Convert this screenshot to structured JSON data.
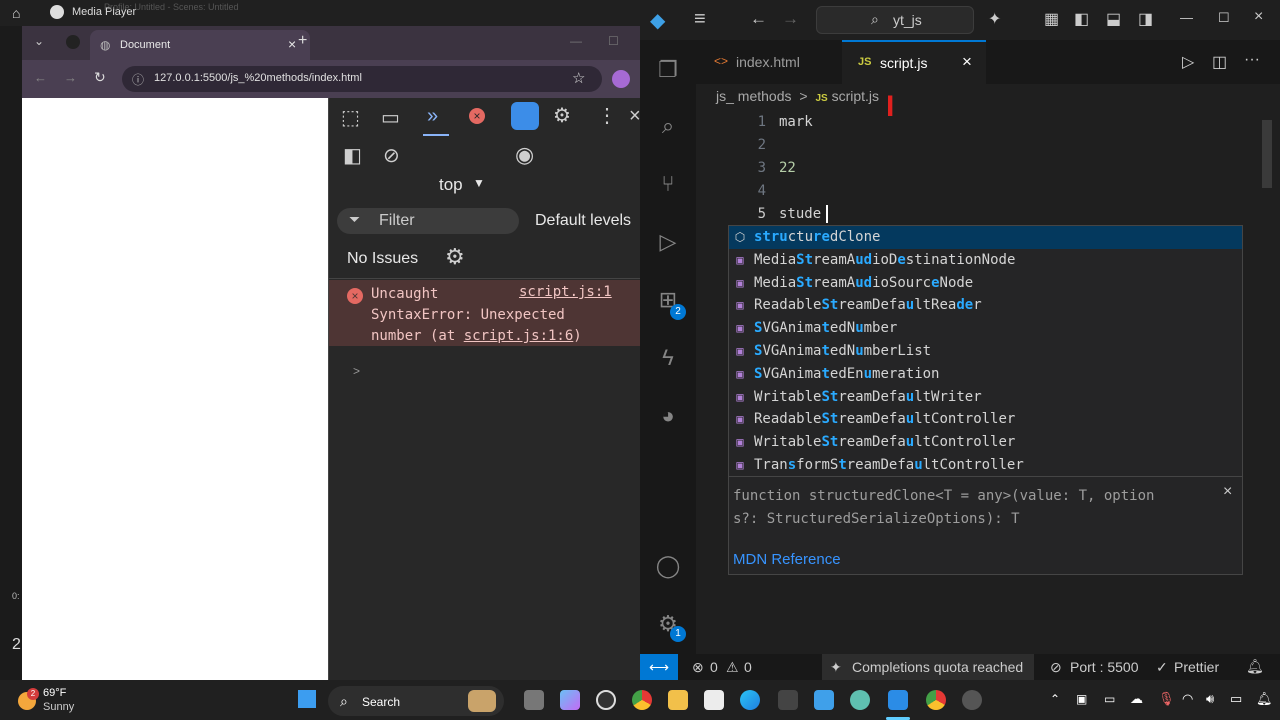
{
  "media_player": {
    "title": "Media Player",
    "subtitle": "Profile: Untitled - Scenes: Untitled"
  },
  "browser": {
    "tab_title": "Document",
    "url": "127.0.0.1:5500/js_%20methods/index.html",
    "devtools": {
      "context": "top",
      "filter_placeholder": "Filter",
      "levels": "Default levels",
      "issues": "No Issues",
      "error_lines": [
        "Uncaught",
        "SyntaxError: Unexpected",
        "number (at "
      ],
      "error_link": "script.js:1",
      "error_link2": "script.js:1:6",
      "error_close": ")",
      "expand": ">"
    }
  },
  "vscode": {
    "search": "yt_js",
    "tabs": [
      {
        "label": "index.html",
        "icon": "<>"
      },
      {
        "label": "script.js",
        "icon": "JS"
      }
    ],
    "breadcrumb": {
      "folder": "js_ methods",
      "sep": ">",
      "file_icon": "JS",
      "file": "script.js"
    },
    "lines": [
      {
        "no": "1",
        "text": "mark"
      },
      {
        "no": "2",
        "text": ""
      },
      {
        "no": "3",
        "text": "22"
      },
      {
        "no": "4",
        "text": ""
      },
      {
        "no": "5",
        "text": "stude"
      }
    ],
    "suggestions": [
      "structuredClone",
      "MediaStreamAudioDestinationNode",
      "MediaStreamAudioSourceNode",
      "ReadableStreamDefaultReader",
      "SVGAnimatedNumber",
      "SVGAnimatedNumberList",
      "SVGAnimatedEnumeration",
      "WritableStreamDefaultWriter",
      "ReadableStreamDefaultController",
      "WritableStreamDefaultController",
      "TransformStreamDefaultController"
    ],
    "details": {
      "signature_line1": "function structuredClone<T = any>(value: T, option",
      "signature_line2": "s?: StructuredSerializeOptions): T",
      "link": "MDN Reference"
    },
    "badges": {
      "extensions": "2",
      "settings": "1"
    },
    "status": {
      "problems": "0",
      "warnings": "0",
      "quota": "Completions quota reached",
      "port": "Port : 5500",
      "prettier": "Prettier"
    }
  },
  "taskbar": {
    "weather_temp": "69°F",
    "weather_desc": "Sunny",
    "weather_badge": "2",
    "search": "Search"
  },
  "left_edge": {
    "time": "0:",
    "num": "2"
  }
}
